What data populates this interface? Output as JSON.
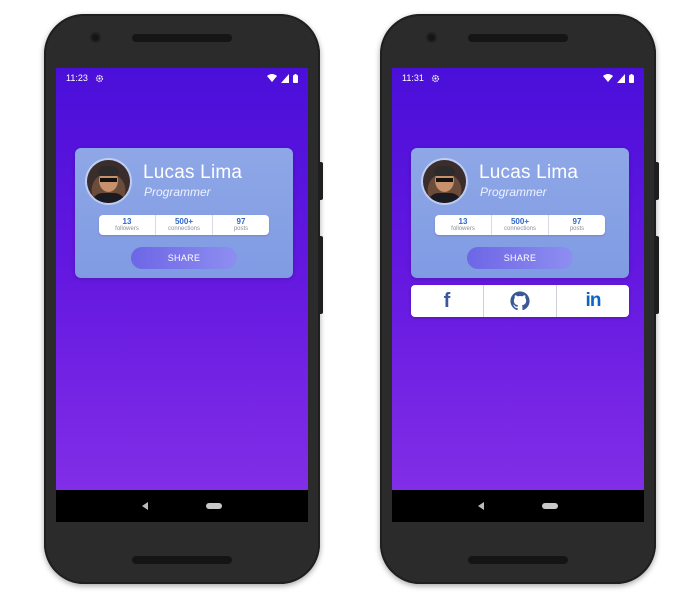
{
  "profile": {
    "name": "Lucas Lima",
    "role": "Programmer",
    "stats": [
      {
        "value": "13",
        "label": "followers"
      },
      {
        "value": "500+",
        "label": "connections"
      },
      {
        "value": "97",
        "label": "posts"
      }
    ],
    "share_label": "SHARE"
  },
  "screens": [
    {
      "time": "11:23"
    },
    {
      "time": "11:31"
    }
  ],
  "social": [
    {
      "icon": "facebook-icon",
      "glyph": "f"
    },
    {
      "icon": "github-icon"
    },
    {
      "icon": "linkedin-icon",
      "glyph": "in"
    }
  ],
  "colors": {
    "gradient_top": "#4a0fd9",
    "gradient_bottom": "#8631e8",
    "card": "#8fa7e6",
    "stat_value": "#2e66c8",
    "facebook": "#3b5998",
    "linkedin": "#0a66c2"
  }
}
